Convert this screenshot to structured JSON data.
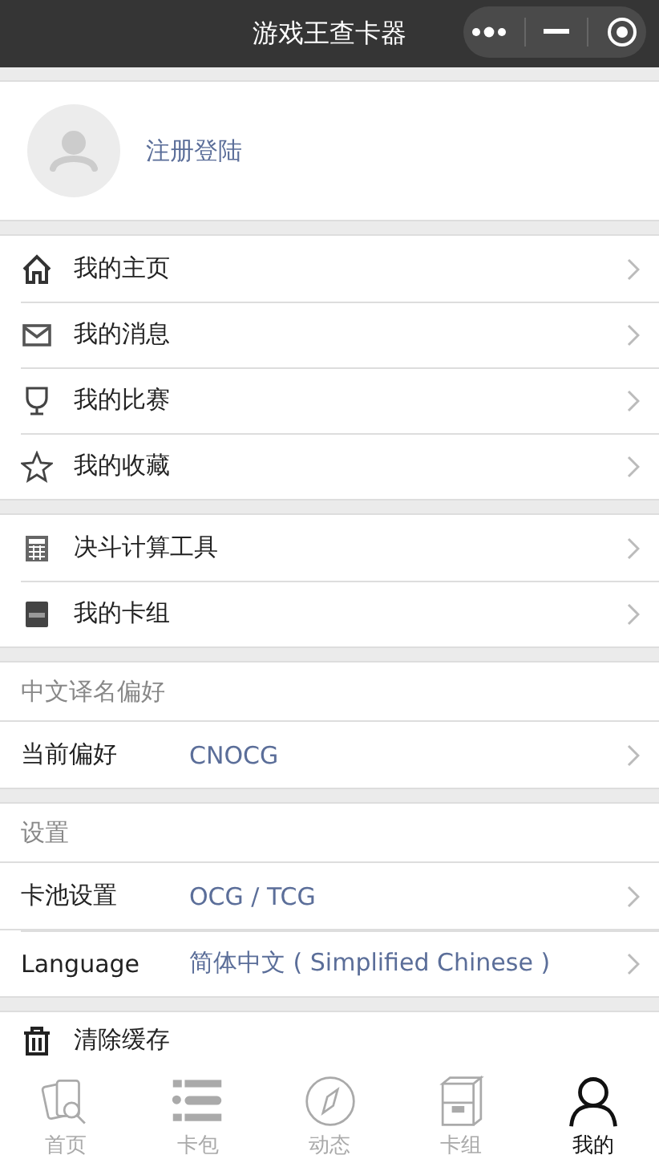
{
  "window": {
    "title": "游戏王查卡器"
  },
  "profile": {
    "login_text": "注册登陆"
  },
  "menu_groups": [
    {
      "items": [
        {
          "label": "我的主页"
        },
        {
          "label": "我的消息"
        },
        {
          "label": "我的比赛"
        },
        {
          "label": "我的收藏"
        }
      ]
    },
    {
      "items": [
        {
          "label": "决斗计算工具"
        },
        {
          "label": "我的卡组"
        }
      ]
    }
  ],
  "settings_sections": [
    {
      "header": "中文译名偏好",
      "rows": [
        {
          "label": "当前偏好",
          "value": "CNOCG"
        }
      ]
    },
    {
      "header": "设置",
      "rows": [
        {
          "label": "卡池设置",
          "value": "OCG / TCG"
        },
        {
          "label": "Language",
          "value": "简体中文 ( Simplified Chinese )"
        }
      ]
    }
  ],
  "clear_cache": {
    "label": "清除缓存"
  },
  "tabs": [
    {
      "label": "首页",
      "selected": false
    },
    {
      "label": "卡包",
      "selected": false
    },
    {
      "label": "动态",
      "selected": false
    },
    {
      "label": "卡组",
      "selected": false
    },
    {
      "label": "我的",
      "selected": true
    }
  ]
}
